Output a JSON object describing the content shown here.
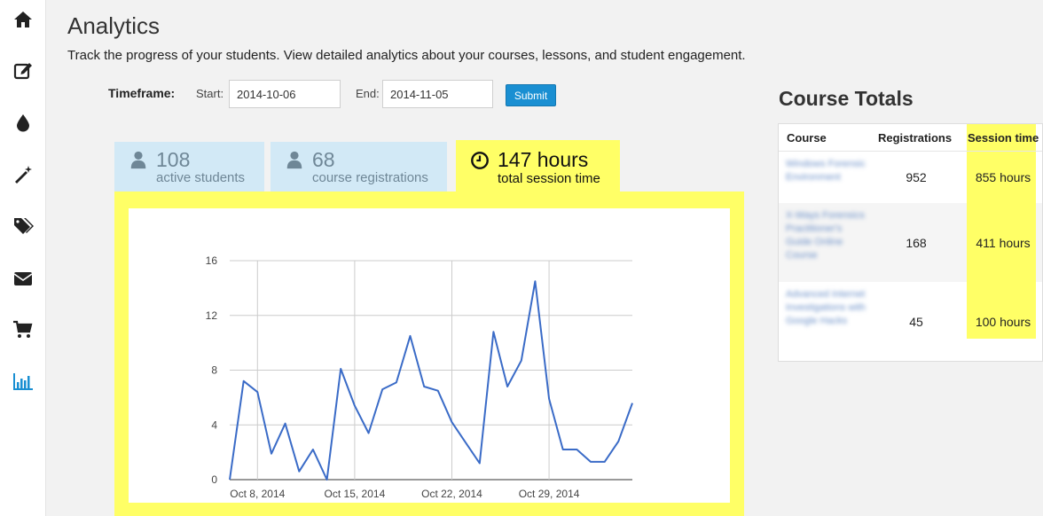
{
  "nav": {
    "items": [
      {
        "icon": "home-icon"
      },
      {
        "icon": "edit-icon"
      },
      {
        "icon": "drop-icon"
      },
      {
        "icon": "magic-wand-icon"
      },
      {
        "icon": "tags-icon"
      },
      {
        "icon": "envelope-icon"
      },
      {
        "icon": "cart-icon"
      },
      {
        "icon": "bar-chart-icon",
        "active": true
      }
    ],
    "active_color": "#1a8fd2",
    "icon_color": "#222222"
  },
  "header": {
    "title": "Analytics",
    "description": "Track the progress of your students. View detailed analytics about your courses, lessons, and student engagement."
  },
  "timeframe": {
    "label": "Timeframe:",
    "start_label": "Start:",
    "start_value": "2014-10-06",
    "end_label": "End:",
    "end_value": "2014-11-05",
    "submit_label": "Submit"
  },
  "stats": {
    "students": {
      "value": "108",
      "label": "active students",
      "icon": "user-icon"
    },
    "registrations": {
      "value": "68",
      "label": "course registrations",
      "icon": "user-icon"
    },
    "session": {
      "value": "147 hours",
      "label": "total session time",
      "icon": "clock-icon",
      "selected": true
    }
  },
  "highlight_color": "#ffff66",
  "chart_data": {
    "type": "line",
    "x_tick_labels": [
      "Oct 8, 2014",
      "Oct 15, 2014",
      "Oct 22, 2014",
      "Oct 29, 2014"
    ],
    "y_tick_labels": [
      "0",
      "4",
      "8",
      "12",
      "16"
    ],
    "ylim": [
      0,
      16
    ],
    "x": [
      "2014-10-06",
      "2014-10-07",
      "2014-10-08",
      "2014-10-09",
      "2014-10-10",
      "2014-10-11",
      "2014-10-12",
      "2014-10-13",
      "2014-10-14",
      "2014-10-15",
      "2014-10-16",
      "2014-10-17",
      "2014-10-18",
      "2014-10-19",
      "2014-10-20",
      "2014-10-21",
      "2014-10-22",
      "2014-10-23",
      "2014-10-24",
      "2014-10-25",
      "2014-10-26",
      "2014-10-27",
      "2014-10-28",
      "2014-10-29",
      "2014-10-30",
      "2014-10-31",
      "2014-11-01",
      "2014-11-02",
      "2014-11-03",
      "2014-11-04",
      "2014-11-05"
    ],
    "values": [
      0,
      7.2,
      6.4,
      1.9,
      4.1,
      0.6,
      2.2,
      0,
      8.1,
      5.4,
      3.4,
      6.6,
      7.1,
      10.5,
      6.8,
      6.5,
      4.2,
      2.7,
      1.2,
      10.8,
      6.8,
      8.7,
      14.5,
      5.9,
      2.2,
      2.2,
      1.3,
      1.3,
      2.8,
      5.6
    ],
    "grid": true,
    "line_color": "#3a6bc7"
  },
  "course_totals": {
    "title": "Course Totals",
    "headers": [
      "Course",
      "Registrations",
      "Session time"
    ],
    "rows": [
      {
        "course": "Windows Forensic Environment",
        "registrations": "952",
        "session_time": "855 hours"
      },
      {
        "course": "X-Ways Forensics Practitioner's Guide Online Course",
        "registrations": "168",
        "session_time": "411 hours"
      },
      {
        "course": "Advanced Internet Investigations with Google Hacks",
        "registrations": "45",
        "session_time": "100 hours"
      }
    ]
  }
}
